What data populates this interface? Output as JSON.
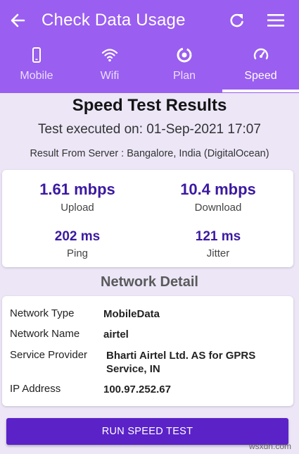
{
  "app_bar": {
    "title": "Check Data Usage",
    "back_icon": "arrow-left-icon",
    "refresh_icon": "refresh-icon",
    "menu_icon": "hamburger-menu-icon",
    "background": "#9a5ef0"
  },
  "tabs": [
    {
      "label": "Mobile",
      "icon": "smartphone-icon",
      "active": false
    },
    {
      "label": "Wifi",
      "icon": "wifi-icon",
      "active": false
    },
    {
      "label": "Plan",
      "icon": "plan-icon",
      "active": false
    },
    {
      "label": "Speed",
      "icon": "speedometer-icon",
      "active": true
    }
  ],
  "results": {
    "title": "Speed Test Results",
    "executed": "Test executed on: 01-Sep-2021 17:07",
    "server": "Result From Server : Bangalore, India (DigitalOcean)"
  },
  "metrics": {
    "upload": {
      "value": "1.61 mbps",
      "label": "Upload"
    },
    "download": {
      "value": "10.4 mbps",
      "label": "Download"
    },
    "ping": {
      "value": "202 ms",
      "label": "Ping"
    },
    "jitter": {
      "value": "121 ms",
      "label": "Jitter"
    }
  },
  "network": {
    "heading": "Network Detail",
    "rows": [
      {
        "key": "Network Type",
        "value": "MobileData"
      },
      {
        "key": "Network Name",
        "value": "airtel"
      },
      {
        "key": "Service Provider",
        "value": "Bharti Airtel Ltd. AS for GPRS Service, IN"
      },
      {
        "key": "IP Address",
        "value": "100.97.252.67"
      }
    ]
  },
  "run_button": {
    "label": "RUN SPEED TEST",
    "color": "#5b22c8"
  },
  "watermark": "wsxdn.com"
}
